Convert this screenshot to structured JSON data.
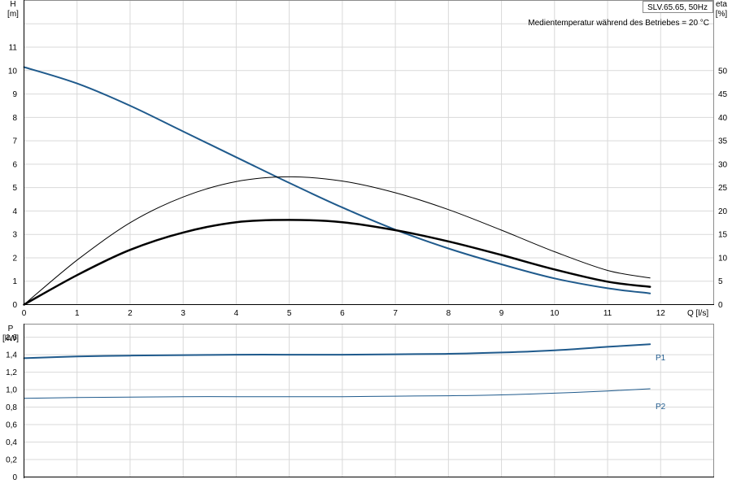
{
  "chart_data": [
    {
      "type": "line",
      "title": "SLV.65.65, 50Hz",
      "note": "Medientemperatur während des Betriebes = 20 °C",
      "xlabel": "Q [l/s]",
      "xlim": [
        0,
        13
      ],
      "xticks": [
        0,
        1,
        2,
        3,
        4,
        5,
        6,
        7,
        8,
        9,
        10,
        11,
        12
      ],
      "y_left": {
        "label": "H",
        "unit": "[m]",
        "lim": [
          0,
          13
        ],
        "ticks": [
          0,
          1,
          2,
          3,
          4,
          5,
          6,
          7,
          8,
          9,
          10,
          11
        ]
      },
      "y_right": {
        "label": "eta",
        "unit": "[%]",
        "lim": [
          0,
          65
        ],
        "ticks": [
          0,
          5,
          10,
          15,
          20,
          25,
          30,
          35,
          40,
          45,
          50
        ]
      },
      "grid": true,
      "series": [
        {
          "axis": "left",
          "color": "#1f5a8c",
          "width": 2,
          "x": [
            0,
            1,
            2,
            3,
            4,
            5,
            6,
            7,
            8,
            9,
            10,
            11,
            11.8
          ],
          "y": [
            10.15,
            9.45,
            8.5,
            7.4,
            6.3,
            5.2,
            4.15,
            3.2,
            2.4,
            1.72,
            1.12,
            0.7,
            0.48
          ]
        },
        {
          "axis": "right",
          "color": "#000000",
          "width": 1,
          "x": [
            0,
            1,
            2,
            3,
            4,
            5,
            6,
            7,
            8,
            9,
            10,
            11,
            11.8
          ],
          "y": [
            0,
            9.5,
            17.5,
            23.0,
            26.3,
            27.3,
            26.4,
            23.9,
            20.3,
            15.9,
            11.3,
            7.3,
            5.7
          ]
        },
        {
          "axis": "right",
          "color": "#000000",
          "width": 2.5,
          "x": [
            0,
            1,
            2,
            3,
            4,
            5,
            6,
            7,
            8,
            9,
            10,
            11,
            11.8
          ],
          "y": [
            0,
            6.3,
            11.7,
            15.4,
            17.6,
            18.1,
            17.6,
            15.9,
            13.5,
            10.6,
            7.5,
            4.9,
            3.8
          ]
        }
      ]
    },
    {
      "type": "line",
      "y_left": {
        "label": "P",
        "unit": "[kW]",
        "lim": [
          0,
          1.75
        ],
        "ticks": [
          "0",
          "0,2",
          "0,4",
          "0,6",
          "0,8",
          "1,0",
          "1,2",
          "1,4",
          "1,6"
        ]
      },
      "xlim": [
        0,
        13
      ],
      "grid": true,
      "series": [
        {
          "name": "P1",
          "color": "#1f5a8c",
          "width": 2,
          "x": [
            0,
            1,
            2,
            3,
            4,
            5,
            6,
            7,
            8,
            9,
            10,
            11,
            11.8
          ],
          "y": [
            1.36,
            1.38,
            1.39,
            1.395,
            1.4,
            1.4,
            1.4,
            1.405,
            1.41,
            1.425,
            1.45,
            1.49,
            1.52
          ]
        },
        {
          "name": "P2",
          "color": "#1f5a8c",
          "width": 1,
          "x": [
            0,
            1,
            2,
            3,
            4,
            5,
            6,
            7,
            8,
            9,
            10,
            11,
            11.8
          ],
          "y": [
            0.9,
            0.91,
            0.915,
            0.92,
            0.92,
            0.92,
            0.92,
            0.925,
            0.93,
            0.94,
            0.96,
            0.985,
            1.01
          ]
        }
      ]
    }
  ]
}
